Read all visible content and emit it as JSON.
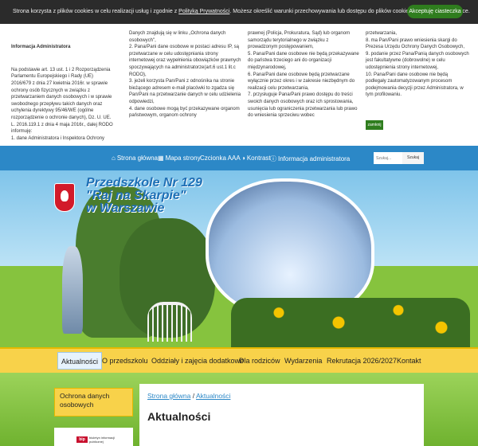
{
  "cookie": {
    "text_before": "Strona korzysta z plików cookies w celu realizacji usług i zgodnie z ",
    "link": "Polityką Prywatności",
    "text_after": ". Możesz określić warunki przechowywania lub dostępu do plików cookies w Twojej przeglądarce.",
    "accept_label": "Akceptuję ciasteczka"
  },
  "admin": {
    "title": "Informacja Administratora",
    "col1": "Na podstawie art. 13 ust. 1 i 2 Rozporządzenia Parlamentu Europejskiego i Rady (UE) 2016/679 z dnia 27 kwietnia 2016r. w sprawie ochrony osób fizycznych w związku z przetwarzaniem danych osobowych i w sprawie swobodnego przepływu takich danych oraz uchylenia dyrektywy 95/46/WE (ogólne rozporządzenie o ochronie danych), Dz. U. UE. L. 2016.119.1 z dnia 4 maja 2016r., dalej RODO informuję:\n1. dane Administratora i Inspektora Ochrony",
    "col2": "Danych znajdują się w linku „Ochrona danych osobowych\",\n2. Pana/Pani dane osobowe w postaci adresu IP, są przetwarzane w celu udostępniania strony internetowej oraz wypełnienia obowiązków prawnych spoczywających na administratorze(art.6 ust.1 lit.c RODO),\n3. jeżeli korzysta Pan/Pani z odnośnika na stronie bieżącego adresem e-mail placówki to zgadza się Pan/Pani na przetwarzanie danych w celu udzielenia odpowiedzi,\n4. dane osobowe mogą być przekazywane organom państwowym, organom ochrony",
    "col3": "prawnej (Policja, Prokuratura, Sąd) lub organom samorządu terytorialnego w związku z prowadzonym postępowaniem,\n5. Pana/Pani dane osobowe nie będą przekazywane do państwa trzeciego ani do organizacji międzynarodowej,\n6. Pana/Pani dane osobowe będą przetwarzane wyłącznie przez okres i w zakresie niezbędnym do realizacji celu przetwarzania,\n7. przysługuje Pana/Pani prawo dostępu do treści swoich danych osobowych oraz ich sprostowania, usunięcia lub ograniczenia przetwarzania lub prawo do wniesienia sprzeciwu wobec",
    "col4": "przetwarzania,\n8. ma Pan/Pani prawo wniesienia skargi do Prezesa Urzędu Ochrony Danych Osobowych,\n9. podanie przez Pana/Panią danych osobowych jest fakultatywne (dobrowolne) w celu udostępnienia strony internetowej,\n10. Pana/Pani dane osobowe nie będą podlegały zautomatyzowanym procesom podejmowania decyzji przez Administratora, w tym profilowaniu.",
    "close_label": "zamknij"
  },
  "toolbar": {
    "items": [
      {
        "icon": "home-icon",
        "glyph": "⌂",
        "label": "Strona główna"
      },
      {
        "icon": "sitemap-icon",
        "glyph": "▦",
        "label": "Mapa strony"
      },
      {
        "label": "Czcionka AAA"
      },
      {
        "icon": "contrast-icon",
        "glyph": "◑",
        "label": "Kontrast"
      },
      {
        "icon": "info-icon",
        "glyph": "ⓘ",
        "label": "Informacja administratora"
      }
    ],
    "search_placeholder": "Szukaj...",
    "search_button": "Szukaj"
  },
  "banner": {
    "line1": "Przedszkole Nr 129",
    "line2": "\"Raj na Skarpie\"",
    "line3": "w Warszawie"
  },
  "nav": {
    "items": [
      "Aktualności",
      "O przedszkolu",
      "Oddziały i zajęcia dodatkowe",
      "Dla rodziców",
      "Wydarzenia",
      "Rekrutacja 2026/2027",
      "Kontakt"
    ],
    "active": "Aktualności"
  },
  "sidebar": {
    "item": "Ochrona danych osobowych",
    "bip_logo": "bip",
    "bip_text": "biuletyn informacji publicznej"
  },
  "main": {
    "breadcrumb_home": "Strona główna",
    "breadcrumb_sep": " / ",
    "breadcrumb_current": "Aktualności",
    "title": "Aktualności"
  }
}
